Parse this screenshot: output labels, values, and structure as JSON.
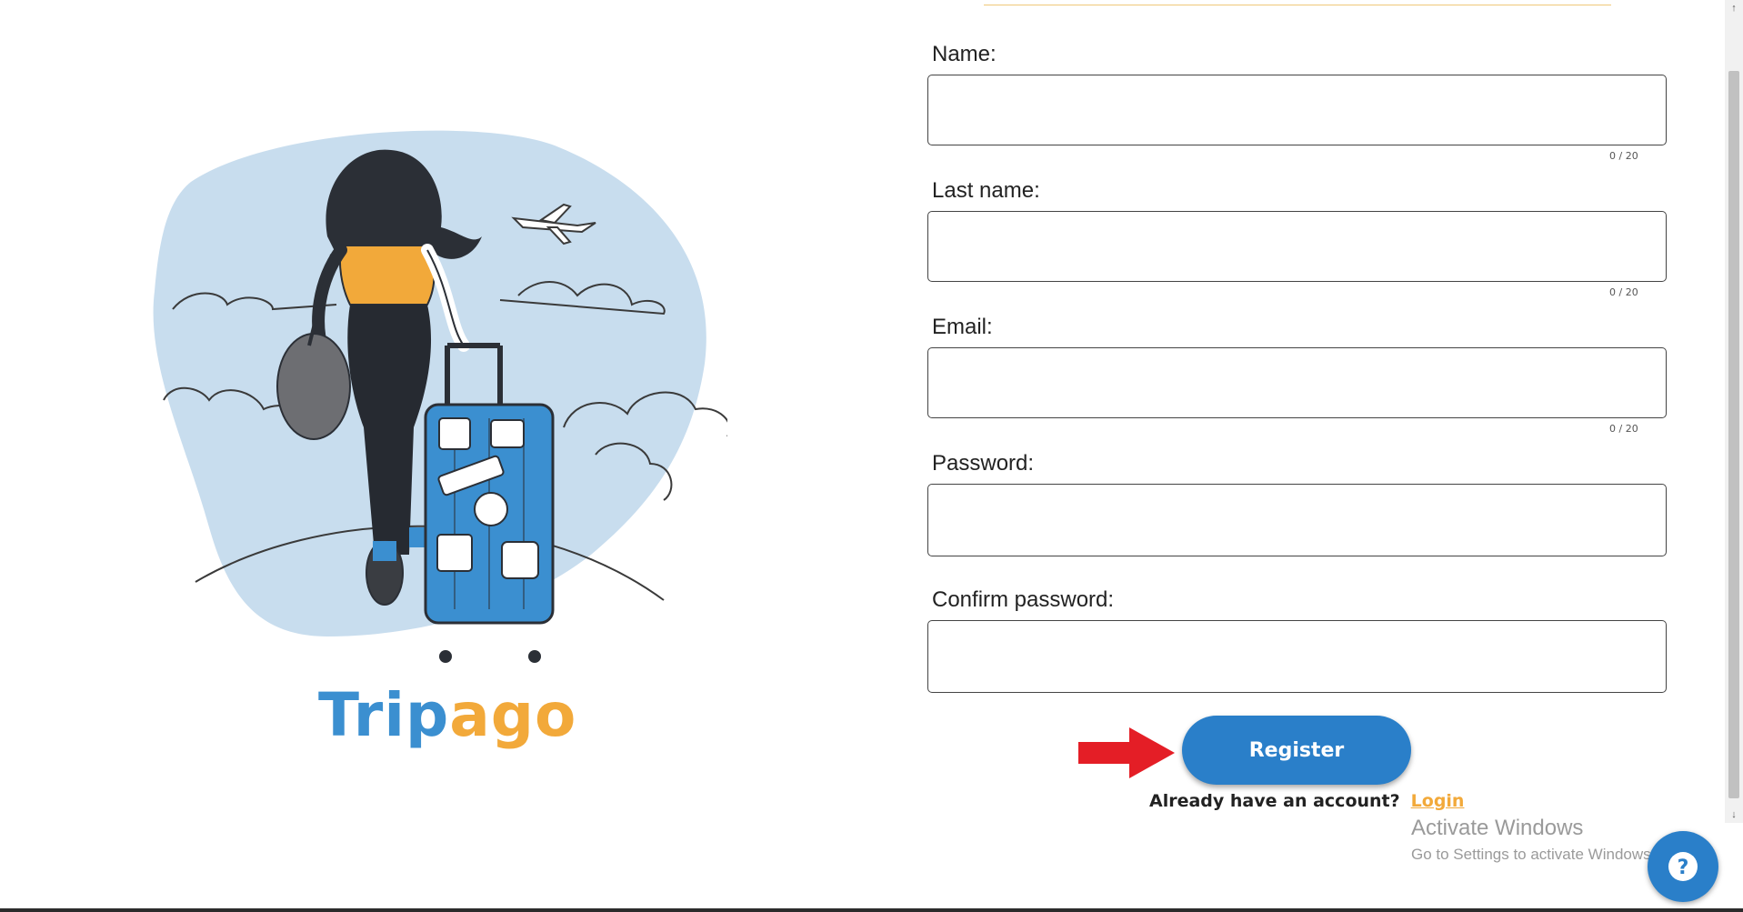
{
  "brand": {
    "part1": "Trip",
    "part2": "ago"
  },
  "form": {
    "fields": [
      {
        "label": "Name:",
        "value": "",
        "counter": "0 / 20"
      },
      {
        "label": "Last name:",
        "value": "",
        "counter": "0 / 20"
      },
      {
        "label": "Email:",
        "value": "",
        "counter": "0 / 20"
      },
      {
        "label": "Password:",
        "value": ""
      },
      {
        "label": "Confirm password:",
        "value": ""
      }
    ],
    "register_label": "Register",
    "account_prompt": "Already have an account?",
    "login_label": "Login"
  },
  "watermark": {
    "title": "Activate Windows",
    "subtitle": "Go to Settings to activate Windows."
  },
  "help": {
    "icon": "question-icon",
    "glyph": "?"
  },
  "scrollbar": {
    "up": "↑",
    "down": "↓"
  },
  "colors": {
    "primary": "#2a7fc9",
    "accent": "#f2a93a",
    "arrow": "#e41e26"
  }
}
